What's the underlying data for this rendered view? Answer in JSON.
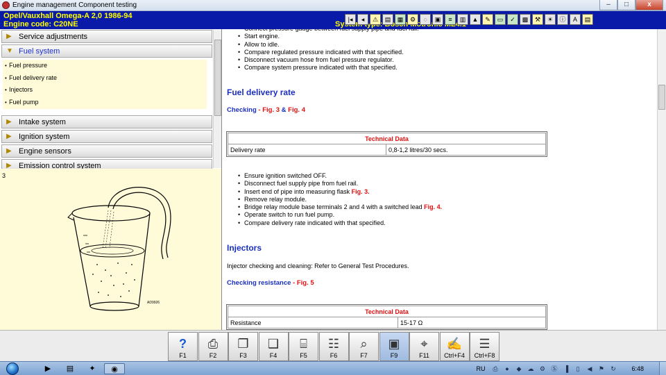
{
  "window": {
    "title": "Engine management Component testing",
    "minimize": "–",
    "maximize": "□",
    "close": "x"
  },
  "header": {
    "vehicle": "Opel/Vauxhall   Omega-A  2,0  1986-94",
    "engine_code": "Engine code: C20NE",
    "system_type": "System type: Bosch Motronic ML4.1"
  },
  "toolbar": {
    "icons": [
      "first-icon",
      "prev-icon",
      "warning-icon",
      "page-icon",
      "diagram-icon",
      "tools-icon",
      "gauge-icon",
      "image-icon",
      "list-icon",
      "book-icon",
      "oil-icon",
      "pen-icon",
      "battery-icon",
      "check-icon",
      "component-icon",
      "wrench-icon",
      "light-icon",
      "info-icon",
      "text-icon",
      "note-icon"
    ],
    "glyphs": [
      "|◂",
      "◂",
      "⚠",
      "▤",
      "▦",
      "⚙",
      "◌",
      "▣",
      "≡",
      "▥",
      "▲",
      "✎",
      "▭",
      "✓",
      "▩",
      "⚒",
      "☀",
      "ⓘ",
      "A",
      "▤"
    ]
  },
  "sidebar": {
    "sections": [
      {
        "label": "Service adjustments"
      },
      {
        "label": "Fuel system"
      },
      {
        "label": "Intake system"
      },
      {
        "label": "Ignition system"
      },
      {
        "label": "Engine sensors"
      },
      {
        "label": "Emission control system"
      }
    ],
    "fuel_items": [
      "Fuel pressure",
      "Fuel delivery rate",
      "Injectors",
      "Fuel pump"
    ]
  },
  "figure": {
    "number": "3",
    "code": "AD9926"
  },
  "content": {
    "top_list": [
      "Connect pressure gauge between fuel supply pipe and fuel rail.",
      "Start engine.",
      "Allow to idle.",
      "Compare regulated pressure indicated with that specified.",
      "Disconnect vacuum hose from fuel pressure regulator.",
      "Compare system pressure indicated with that specified."
    ],
    "fuel_delivery": {
      "heading": "Fuel delivery rate",
      "checking_label": "Checking",
      "checking_sep": " - ",
      "fig3": "Fig. 3",
      "amp": " & ",
      "fig4": "Fig. 4",
      "table": {
        "header": "Technical Data",
        "row_label": "Delivery rate",
        "row_value": "0,8-1,2 litres/30 secs."
      },
      "steps": [
        {
          "text": "Ensure ignition switched OFF.",
          "ref": ""
        },
        {
          "text": "Disconnect fuel supply pipe from fuel rail.",
          "ref": ""
        },
        {
          "text": "Insert end of pipe into measuring flask ",
          "ref": "Fig. 3."
        },
        {
          "text": "Remove relay module.",
          "ref": ""
        },
        {
          "text": "Bridge relay module base terminals 2 and 4 with a switched lead ",
          "ref": "Fig. 4."
        },
        {
          "text": "Operate switch to run fuel pump.",
          "ref": ""
        },
        {
          "text": "Compare delivery rate indicated with that specified.",
          "ref": ""
        }
      ]
    },
    "injectors": {
      "heading": "Injectors",
      "text": "Injector checking and cleaning: Refer to General Test Procedures.",
      "checking_label": "Checking resistance",
      "checking_sep": " - ",
      "fig5": "Fig. 5",
      "table": {
        "header": "Technical Data",
        "row_label": "Resistance",
        "row_value": "15-17 Ω"
      }
    }
  },
  "fkeys": [
    {
      "label": "F1",
      "icon": "help-icon",
      "glyph": "?"
    },
    {
      "label": "F2",
      "icon": "print-icon",
      "glyph": "⎙"
    },
    {
      "label": "F3",
      "icon": "copy-icon",
      "glyph": "❐"
    },
    {
      "label": "F4",
      "icon": "paste-icon",
      "glyph": "❑"
    },
    {
      "label": "F5",
      "icon": "component-icon",
      "glyph": "⌸"
    },
    {
      "label": "F6",
      "icon": "connector-icon",
      "glyph": "☷"
    },
    {
      "label": "F7",
      "icon": "zoom-icon",
      "glyph": "⌕"
    },
    {
      "label": "F9",
      "icon": "figure-icon",
      "glyph": "▣"
    },
    {
      "label": "F11",
      "icon": "diagnosis-icon",
      "glyph": "⌖"
    },
    {
      "label": "Ctrl+F4",
      "icon": "notes-icon",
      "glyph": "✍"
    },
    {
      "label": "Ctrl+F8",
      "icon": "table-icon",
      "glyph": "☰"
    }
  ],
  "taskbar": {
    "apps": [
      "media-player-icon",
      "explorer-icon",
      "visual-studio-icon",
      "engine-app-icon"
    ],
    "glyphs": [
      "▶",
      "▤",
      "✦",
      "◉"
    ],
    "language": "RU",
    "tray_icons": [
      "print-icon",
      "stop-icon",
      "shield-icon",
      "cloud-icon",
      "settings-icon",
      "skype-icon",
      "network-icon",
      "battery-icon",
      "speaker-icon",
      "flag-icon",
      "sync-icon"
    ],
    "tray_glyphs": [
      "⎙",
      "●",
      "◆",
      "☁",
      "⚙",
      "Ⓢ",
      "▐",
      "▯",
      "◀",
      "⚑",
      "↻"
    ],
    "time": "6:48"
  }
}
